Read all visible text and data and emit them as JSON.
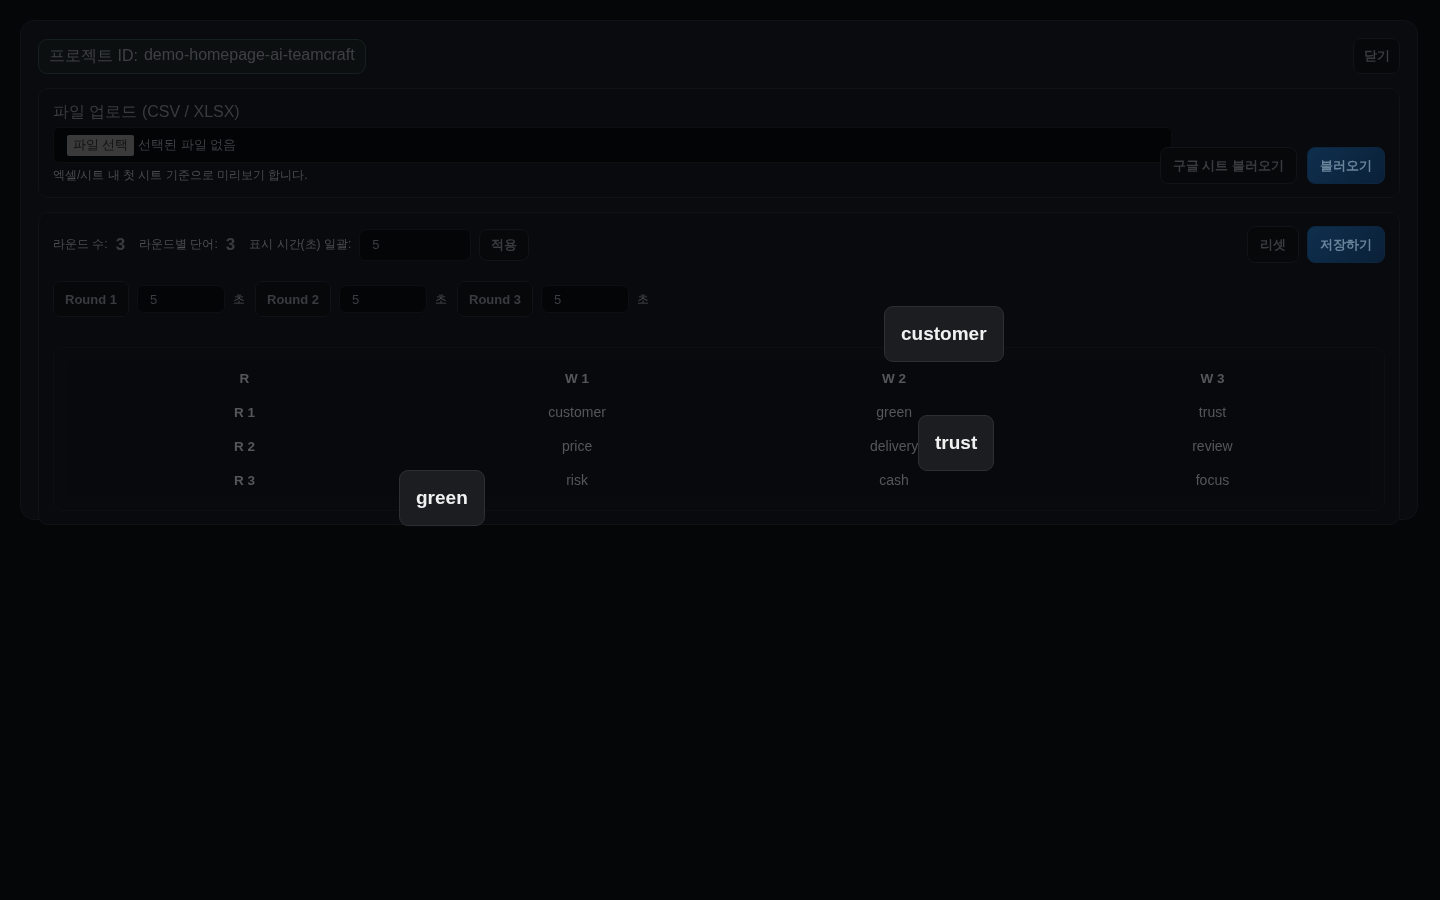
{
  "project": {
    "label": "프로젝트 ID:",
    "id": "demo-homepage-ai-teamcraft"
  },
  "close_button": "닫기",
  "upload": {
    "title": "파일 업로드 (CSV / XLSX)",
    "file_button": "파일 선택",
    "file_status": "선택된 파일 없음",
    "hint": "엑셀/시트 내 첫 시트 기준으로 미리보기 합니다.",
    "buttons": [
      {
        "label": "구글 시트 불러오기",
        "kind": "secondary"
      },
      {
        "label": "불러오기",
        "kind": "primary"
      }
    ]
  },
  "settings": {
    "round_count_label": "라운드 수:",
    "round_count": "3",
    "words_label": "라운드별 단어:",
    "words": "3",
    "time_label": "표시 시간(초) 일괄:",
    "time_value": "5",
    "apply_button": "적용",
    "buttons": [
      {
        "label": "리셋",
        "kind": "secondary"
      },
      {
        "label": "저장하기",
        "kind": "primary"
      }
    ],
    "rounds": [
      {
        "label": "Round 1",
        "value": "5",
        "unit": "초"
      },
      {
        "label": "Round 2",
        "value": "5",
        "unit": "초"
      },
      {
        "label": "Round 3",
        "value": "5",
        "unit": "초"
      }
    ]
  },
  "table": {
    "columns": [
      "R",
      "W 1",
      "W 2",
      "W 3"
    ],
    "rows": [
      [
        "R 1",
        "customer",
        "green",
        "trust"
      ],
      [
        "R 2",
        "price",
        "delivery",
        "review"
      ],
      [
        "R 3",
        "risk",
        "cash",
        "focus"
      ]
    ]
  },
  "floating_words": [
    {
      "text": "customer"
    },
    {
      "text": "trust"
    },
    {
      "text": "green"
    }
  ]
}
